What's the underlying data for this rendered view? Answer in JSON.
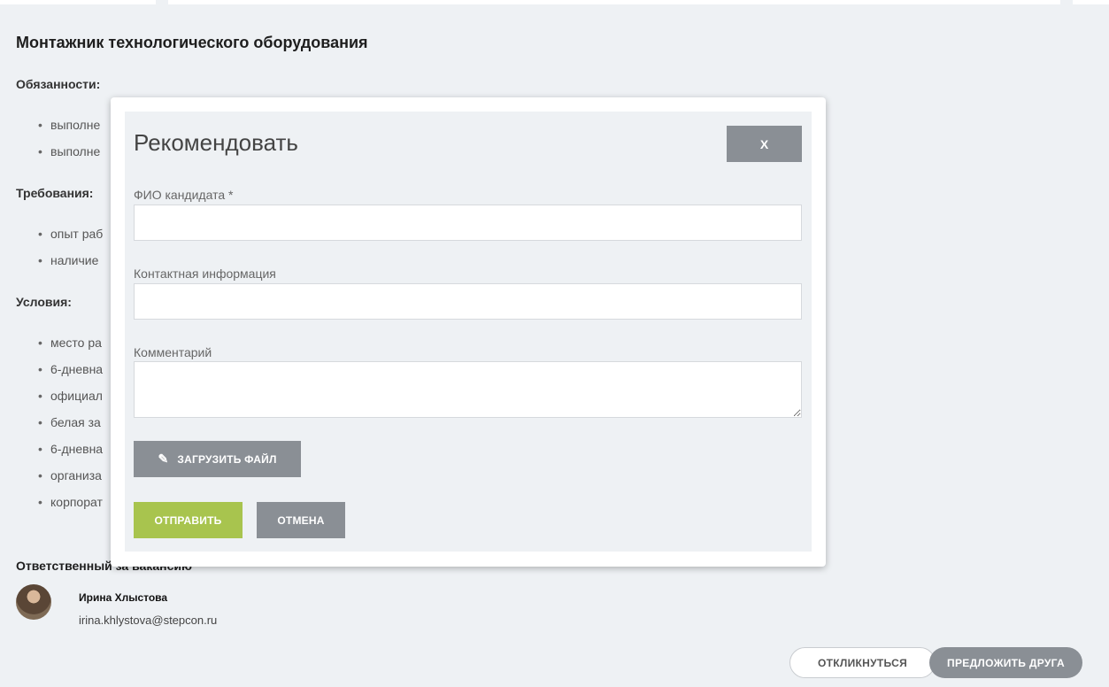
{
  "job": {
    "title": "Монтажник технологического оборудования",
    "duties_heading": "Обязанности:",
    "duties": [
      "выполне",
      "выполне"
    ],
    "requirements_heading": "Требования:",
    "requirements": [
      "опыт раб",
      "наличие"
    ],
    "conditions_heading": "Условия:",
    "conditions": [
      "место ра",
      "6-дневна",
      "официал",
      "белая за",
      "6-дневна",
      "организа",
      "корпорат"
    ]
  },
  "responsible": {
    "heading": "Ответственный за вакансию",
    "name": "Ирина Хлыстова",
    "email": "irina.khlystova@stepcon.ru"
  },
  "actions": {
    "respond_label": "ОТКЛИКНУТЬСЯ",
    "suggest_label": "ПРЕДЛОЖИТЬ ДРУГА"
  },
  "modal": {
    "title": "Рекомендовать",
    "close_label": "X",
    "fio_label": "ФИО кандидата *",
    "fio_value": "",
    "contact_label": "Контактная информация",
    "contact_value": "",
    "comment_label": "Комментарий",
    "comment_value": "",
    "upload_icon": "pencil-icon",
    "upload_label": "ЗАГРУЗИТЬ ФАЙЛ",
    "send_label": "ОТПРАВИТЬ",
    "cancel_label": "ОТМЕНА"
  },
  "colors": {
    "page_bg": "#eef1f4",
    "button_gray": "#8a8f95",
    "button_green": "#a8c44e"
  }
}
